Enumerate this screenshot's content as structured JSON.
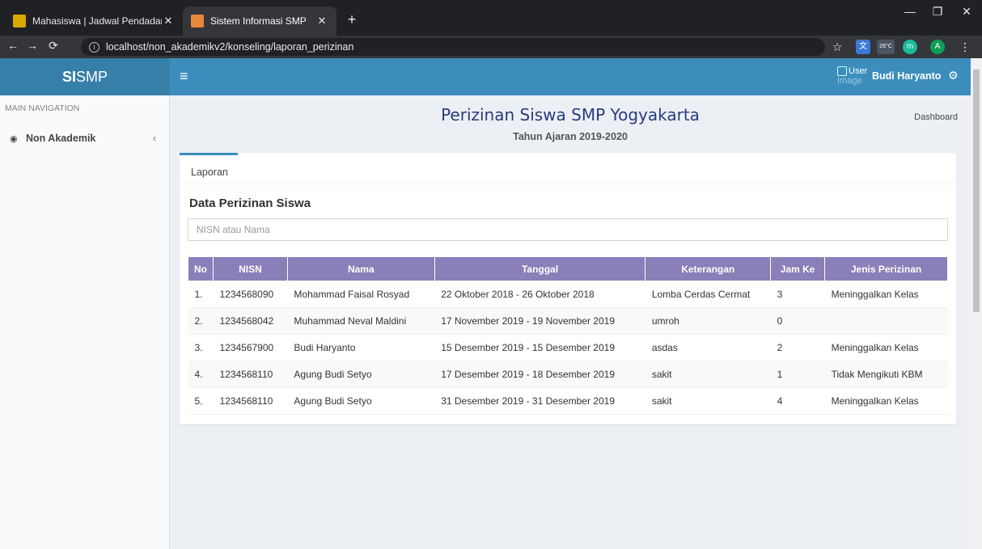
{
  "browser": {
    "tabs": [
      {
        "title": "Mahasiswa | Jadwal Pendadaran"
      },
      {
        "title": "Sistem Informasi SMP"
      }
    ],
    "url": "localhost/non_akademikv2/konseling/laporan_perizinan",
    "extension_labels": [
      "m",
      "A"
    ],
    "weather": "26°C"
  },
  "app": {
    "logo_bold": "SI",
    "logo_rest": "SMP",
    "user_image_alt1": "User",
    "user_image_alt2": "Image",
    "user_name": "Budi Haryanto"
  },
  "sidebar": {
    "header": "MAIN NAVIGATION",
    "items": [
      {
        "label": "Non Akademik"
      }
    ]
  },
  "content": {
    "title": "Perizinan Siswa SMP Yogyakarta",
    "subtitle": "Tahun Ajaran 2019-2020",
    "breadcrumb": "Dashboard",
    "tab": "Laporan",
    "box_title": "Data Perizinan Siswa",
    "search_placeholder": "NISN atau Nama"
  },
  "table": {
    "headers": [
      "No",
      "NISN",
      "Nama",
      "Tanggal",
      "Keterangan",
      "Jam Ke",
      "Jenis Perizinan"
    ],
    "rows": [
      [
        "1.",
        "1234568090",
        "Mohammad Faisal Rosyad",
        "22 Oktober 2018 - 26 Oktober 2018",
        "Lomba Cerdas Cermat",
        "3",
        "Meninggalkan Kelas"
      ],
      [
        "2.",
        "1234568042",
        "Muhammad Neval Maldini",
        "17 November 2019 - 19 November 2019",
        "umroh",
        "0",
        ""
      ],
      [
        "3.",
        "1234567900",
        "Budi Haryanto",
        "15 Desember 2019 - 15 Desember 2019",
        "asdas",
        "2",
        "Meninggalkan Kelas"
      ],
      [
        "4.",
        "1234568110",
        "Agung Budi Setyo",
        "17 Desember 2019 - 18 Desember 2019",
        "sakit",
        "1",
        "Tidak Mengikuti KBM"
      ],
      [
        "5.",
        "1234568110",
        "Agung Budi Setyo",
        "31 Desember 2019 - 31 Desember 2019",
        "sakit",
        "4",
        "Meninggalkan Kelas"
      ]
    ]
  },
  "colors": {
    "header_bg": "#3c8dbc",
    "logo_bg": "#367fa9",
    "table_header": "#8a7fb8",
    "title": "#2a3a7c"
  }
}
